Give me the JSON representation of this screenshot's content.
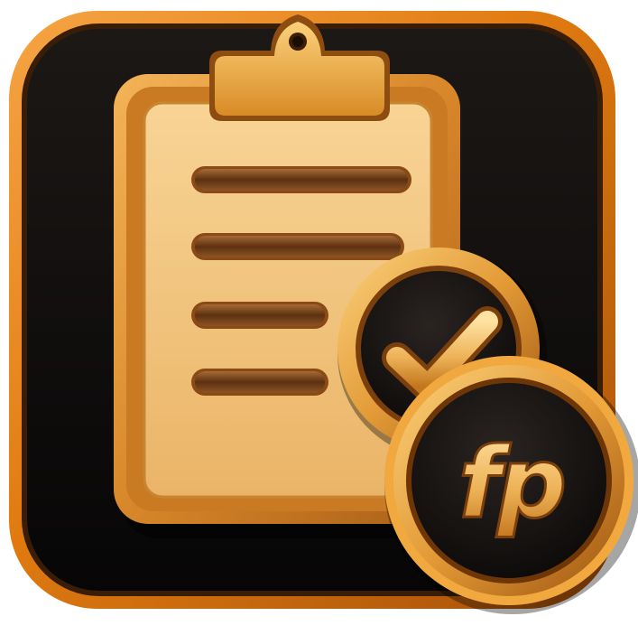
{
  "icon": {
    "name": "clipboard-checklist-app-icon",
    "badge_text": "fp",
    "check_icon": "checkmark-icon",
    "clipboard_icon": "clipboard-icon"
  },
  "colors": {
    "background": "#ffffff",
    "tile_dark": "#0d0b0a",
    "tile_rim": "#e07a10",
    "gold_light": "#f6cf80",
    "gold_mid": "#e9a94b",
    "gold_dark": "#b8681a",
    "bar_brown": "#6b3a14",
    "badge_dark": "#121010"
  },
  "checklist": {
    "line_count": 4
  }
}
